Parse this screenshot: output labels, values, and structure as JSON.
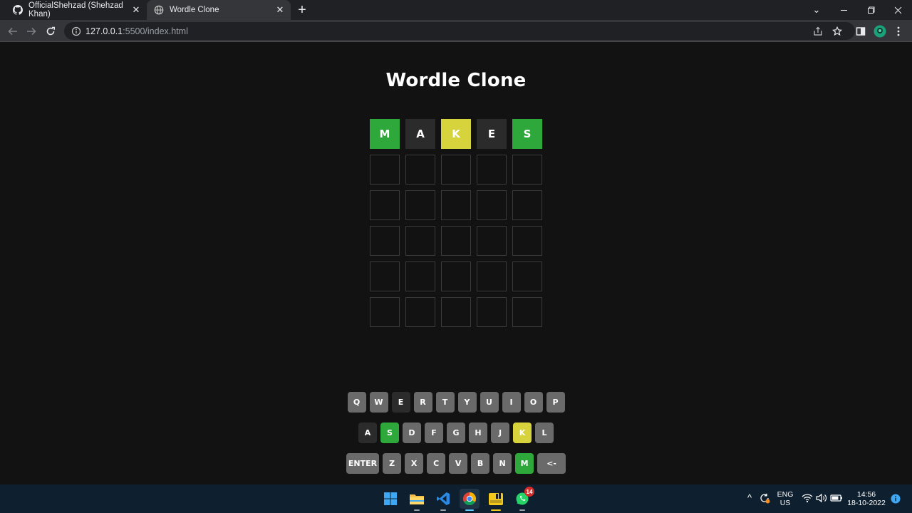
{
  "browser": {
    "tabs": [
      {
        "title": "OfficialShehzad (Shehzad Khan)",
        "favicon": "github-icon"
      },
      {
        "title": "Wordle Clone",
        "favicon": "globe-icon"
      }
    ],
    "url_host": "127.0.0.1",
    "url_path": ":5500/index.html"
  },
  "page": {
    "title": "Wordle Clone"
  },
  "board": {
    "rows": [
      [
        {
          "letter": "M",
          "state": "correct"
        },
        {
          "letter": "A",
          "state": "absent"
        },
        {
          "letter": "K",
          "state": "present"
        },
        {
          "letter": "E",
          "state": "absent"
        },
        {
          "letter": "S",
          "state": "correct"
        }
      ],
      [
        {
          "letter": "",
          "state": "empty"
        },
        {
          "letter": "",
          "state": "empty"
        },
        {
          "letter": "",
          "state": "empty"
        },
        {
          "letter": "",
          "state": "empty"
        },
        {
          "letter": "",
          "state": "empty"
        }
      ],
      [
        {
          "letter": "",
          "state": "empty"
        },
        {
          "letter": "",
          "state": "empty"
        },
        {
          "letter": "",
          "state": "empty"
        },
        {
          "letter": "",
          "state": "empty"
        },
        {
          "letter": "",
          "state": "empty"
        }
      ],
      [
        {
          "letter": "",
          "state": "empty"
        },
        {
          "letter": "",
          "state": "empty"
        },
        {
          "letter": "",
          "state": "empty"
        },
        {
          "letter": "",
          "state": "empty"
        },
        {
          "letter": "",
          "state": "empty"
        }
      ],
      [
        {
          "letter": "",
          "state": "empty"
        },
        {
          "letter": "",
          "state": "empty"
        },
        {
          "letter": "",
          "state": "empty"
        },
        {
          "letter": "",
          "state": "empty"
        },
        {
          "letter": "",
          "state": "empty"
        }
      ],
      [
        {
          "letter": "",
          "state": "empty"
        },
        {
          "letter": "",
          "state": "empty"
        },
        {
          "letter": "",
          "state": "empty"
        },
        {
          "letter": "",
          "state": "empty"
        },
        {
          "letter": "",
          "state": "empty"
        }
      ]
    ]
  },
  "keyboard": {
    "rows": [
      [
        {
          "label": "Q",
          "state": "unused"
        },
        {
          "label": "W",
          "state": "unused"
        },
        {
          "label": "E",
          "state": "absent"
        },
        {
          "label": "R",
          "state": "unused"
        },
        {
          "label": "T",
          "state": "unused"
        },
        {
          "label": "Y",
          "state": "unused"
        },
        {
          "label": "U",
          "state": "unused"
        },
        {
          "label": "I",
          "state": "unused"
        },
        {
          "label": "O",
          "state": "unused"
        },
        {
          "label": "P",
          "state": "unused"
        }
      ],
      [
        {
          "label": "A",
          "state": "absent"
        },
        {
          "label": "S",
          "state": "correct"
        },
        {
          "label": "D",
          "state": "unused"
        },
        {
          "label": "F",
          "state": "unused"
        },
        {
          "label": "G",
          "state": "unused"
        },
        {
          "label": "H",
          "state": "unused"
        },
        {
          "label": "J",
          "state": "unused"
        },
        {
          "label": "K",
          "state": "present"
        },
        {
          "label": "L",
          "state": "unused"
        }
      ],
      [
        {
          "label": "ENTER",
          "state": "unused",
          "wide": true
        },
        {
          "label": "Z",
          "state": "unused"
        },
        {
          "label": "X",
          "state": "unused"
        },
        {
          "label": "C",
          "state": "unused"
        },
        {
          "label": "V",
          "state": "unused"
        },
        {
          "label": "B",
          "state": "unused"
        },
        {
          "label": "N",
          "state": "unused"
        },
        {
          "label": "M",
          "state": "correct"
        },
        {
          "label": "<-",
          "state": "unused",
          "wide": true
        }
      ]
    ]
  },
  "taskbar": {
    "apps": [
      "windows-start-icon",
      "file-explorer-icon",
      "vscode-icon",
      "chrome-icon",
      "player-app-icon",
      "whatsapp-icon"
    ],
    "whatsapp_badge": "14",
    "language_top": "ENG",
    "language_bottom": "US",
    "time": "14:56",
    "date": "18-10-2022"
  },
  "colors": {
    "correct": "#2ea83a",
    "present": "#d6d33c",
    "absent": "#2b2b2b",
    "key_default": "#6a6a6a",
    "page_background": "#121212"
  }
}
